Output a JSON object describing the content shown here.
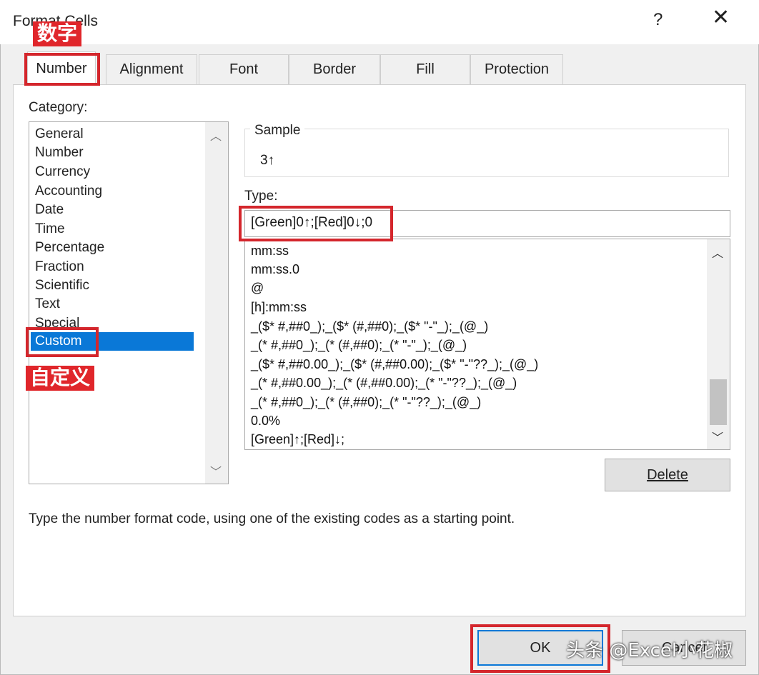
{
  "window": {
    "title": "Format Cells",
    "help_label": "?",
    "close_label": "✕"
  },
  "tabs": [
    "Number",
    "Alignment",
    "Font",
    "Border",
    "Fill",
    "Protection"
  ],
  "category": {
    "label": "Category:",
    "items": [
      "General",
      "Number",
      "Currency",
      "Accounting",
      "Date",
      "Time",
      "Percentage",
      "Fraction",
      "Scientific",
      "Text",
      "Special",
      "Custom"
    ],
    "selected": "Custom"
  },
  "sample": {
    "label": "Sample",
    "value": "3↑"
  },
  "type": {
    "label": "Type:",
    "value": "[Green]0↑;[Red]0↓;0",
    "formats": [
      "mm:ss",
      "mm:ss.0",
      "@",
      "[h]:mm:ss",
      "_($* #,##0_);_($* (#,##0);_($* \"-\"_);_(@_)",
      "_(* #,##0_);_(* (#,##0);_(* \"-\"_);_(@_)",
      "_($* #,##0.00_);_($* (#,##0.00);_($* \"-\"??_);_(@_)",
      "_(* #,##0.00_);_(* (#,##0.00);_(* \"-\"??_);_(@_)",
      "_(* #,##0_);_(* (#,##0);_(* \"-\"??_);_(@_)",
      "0.0%",
      "[Green]↑;[Red]↓;"
    ]
  },
  "buttons": {
    "delete": "Delete",
    "ok": "OK",
    "cancel": "Cancel"
  },
  "description": "Type the number format code, using one of the existing codes as a starting point.",
  "annotations": {
    "number_cn": "数字",
    "custom_cn": "自定义",
    "watermark": "头条 @Excel小花椒"
  },
  "colors": {
    "selection": "#0a78d7",
    "annotation_red": "#d4262c"
  }
}
